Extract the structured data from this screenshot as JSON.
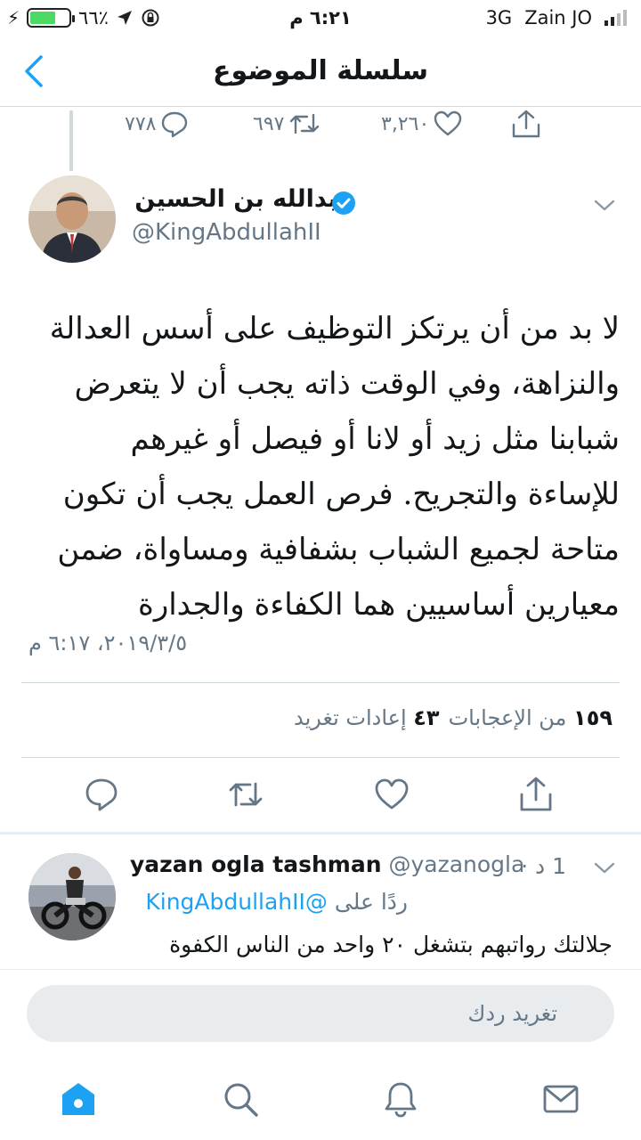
{
  "status_bar": {
    "battery_text": "٦٦٪",
    "battery_level": 0.66,
    "time": "٦:٢١ م",
    "network": "3G",
    "carrier": "Zain JO"
  },
  "nav": {
    "title": "سلسلة الموضوع"
  },
  "previous_tweet": {
    "replies": "٧٧٨",
    "retweets": "٦٩٧",
    "likes": "٣,٢٦٠"
  },
  "main_tweet": {
    "author_name": "عبدالله بن الحسين",
    "author_handle": "@KingAbdullahII",
    "text": "لا بد من أن يرتكز التوظيف على أسس العدالة والنزاهة، وفي الوقت ذاته يجب أن لا يتعرض شبابنا مثل زيد أو لانا أو فيصل أو غيرهم للإساءة والتجريح. فرص العمل يجب أن تكون متاحة لجميع الشباب بشفافية ومساواة، ضمن معيارين أساسيين هما الكفاءة والجدارة",
    "timestamp": "٢٠١٩/٣/٥، ٦:١٧ م",
    "likes_count": "١٥٩",
    "likes_label": "من الإعجابات",
    "retweets_count": "٤٣",
    "retweets_label": "إعادات تغريد"
  },
  "reply": {
    "name": "yazan ogla tashman",
    "handle": "@yazanogla",
    "time": "1 د ·",
    "replying_prefix": "ردًا على",
    "replying_to": "@KingAbdullahII",
    "text": "جلالتك رواتبهم بتشغل ٢٠ واحد من الناس الكفوة"
  },
  "compose": {
    "placeholder": "تغريد ردك"
  },
  "colors": {
    "accent": "#1da1f2",
    "secondary_text": "#657786",
    "divider": "#cfd9de"
  },
  "icons": [
    "back-icon",
    "reply-icon",
    "retweet-icon",
    "like-icon",
    "share-icon",
    "verified-icon",
    "chevron-down-icon",
    "home-icon",
    "search-icon",
    "notifications-icon",
    "messages-icon"
  ]
}
